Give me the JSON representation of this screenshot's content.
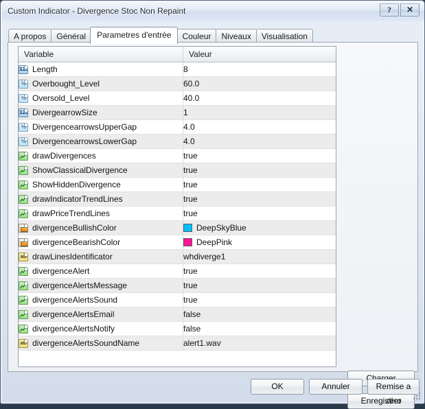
{
  "window": {
    "title": "Custom Indicator - Divergence Stoc Non Repaint",
    "help_button": "?",
    "close_button": "✕"
  },
  "tabs": [
    {
      "label": "A propos",
      "active": false
    },
    {
      "label": "Général",
      "active": false
    },
    {
      "label": "Parametres d'entrée",
      "active": true
    },
    {
      "label": "Couleur",
      "active": false
    },
    {
      "label": "Niveaux",
      "active": false
    },
    {
      "label": "Visualisation",
      "active": false
    }
  ],
  "table": {
    "columns": [
      "Variable",
      "Valeur"
    ],
    "rows": [
      {
        "icon": "int-icon",
        "type": "int",
        "variable": "Length",
        "value": "8"
      },
      {
        "icon": "double-icon",
        "type": "double",
        "variable": "Overbought_Level",
        "value": "60.0"
      },
      {
        "icon": "double-icon",
        "type": "double",
        "variable": "Oversold_Level",
        "value": "40.0"
      },
      {
        "icon": "int-icon",
        "type": "int",
        "variable": "DivergearrowSize",
        "value": "1"
      },
      {
        "icon": "double-icon",
        "type": "double",
        "variable": "DivergencearrowsUpperGap",
        "value": "4.0"
      },
      {
        "icon": "double-icon",
        "type": "double",
        "variable": "DivergencearrowsLowerGap",
        "value": "4.0"
      },
      {
        "icon": "bool-icon",
        "type": "bool",
        "variable": "drawDivergences",
        "value": "true"
      },
      {
        "icon": "bool-icon",
        "type": "bool",
        "variable": "ShowClassicalDivergence",
        "value": "true"
      },
      {
        "icon": "bool-icon",
        "type": "bool",
        "variable": "ShowHiddenDivergence",
        "value": "true"
      },
      {
        "icon": "bool-icon",
        "type": "bool",
        "variable": "drawIndicatorTrendLines",
        "value": "true"
      },
      {
        "icon": "bool-icon",
        "type": "bool",
        "variable": "drawPriceTrendLines",
        "value": "true"
      },
      {
        "icon": "color-icon",
        "type": "color",
        "variable": "divergenceBullishColor",
        "value": "DeepSkyBlue",
        "swatch": "#00BFFF"
      },
      {
        "icon": "color-icon",
        "type": "color",
        "variable": "divergenceBearishColor",
        "value": "DeepPink",
        "swatch": "#FF1493"
      },
      {
        "icon": "string-icon",
        "type": "string",
        "variable": "drawLinesIdentificator",
        "value": "whdiverge1"
      },
      {
        "icon": "bool-icon",
        "type": "bool",
        "variable": "divergenceAlert",
        "value": "true"
      },
      {
        "icon": "bool-icon",
        "type": "bool",
        "variable": "divergenceAlertsMessage",
        "value": "true"
      },
      {
        "icon": "bool-icon",
        "type": "bool",
        "variable": "divergenceAlertsSound",
        "value": "true"
      },
      {
        "icon": "bool-icon",
        "type": "bool",
        "variable": "divergenceAlertsEmail",
        "value": "false"
      },
      {
        "icon": "bool-icon",
        "type": "bool",
        "variable": "divergenceAlertsNotify",
        "value": "false"
      },
      {
        "icon": "string-icon",
        "type": "string",
        "variable": "divergenceAlertsSoundName",
        "value": "alert1.wav"
      }
    ]
  },
  "buttons": {
    "charger": "Charger",
    "enregistrer": "Enregistrer",
    "ok": "OK",
    "annuler": "Annuler",
    "reset": "Remise a zéro"
  },
  "icon_glyphs": {
    "int": "123",
    "double": "½",
    "string": "ab"
  }
}
